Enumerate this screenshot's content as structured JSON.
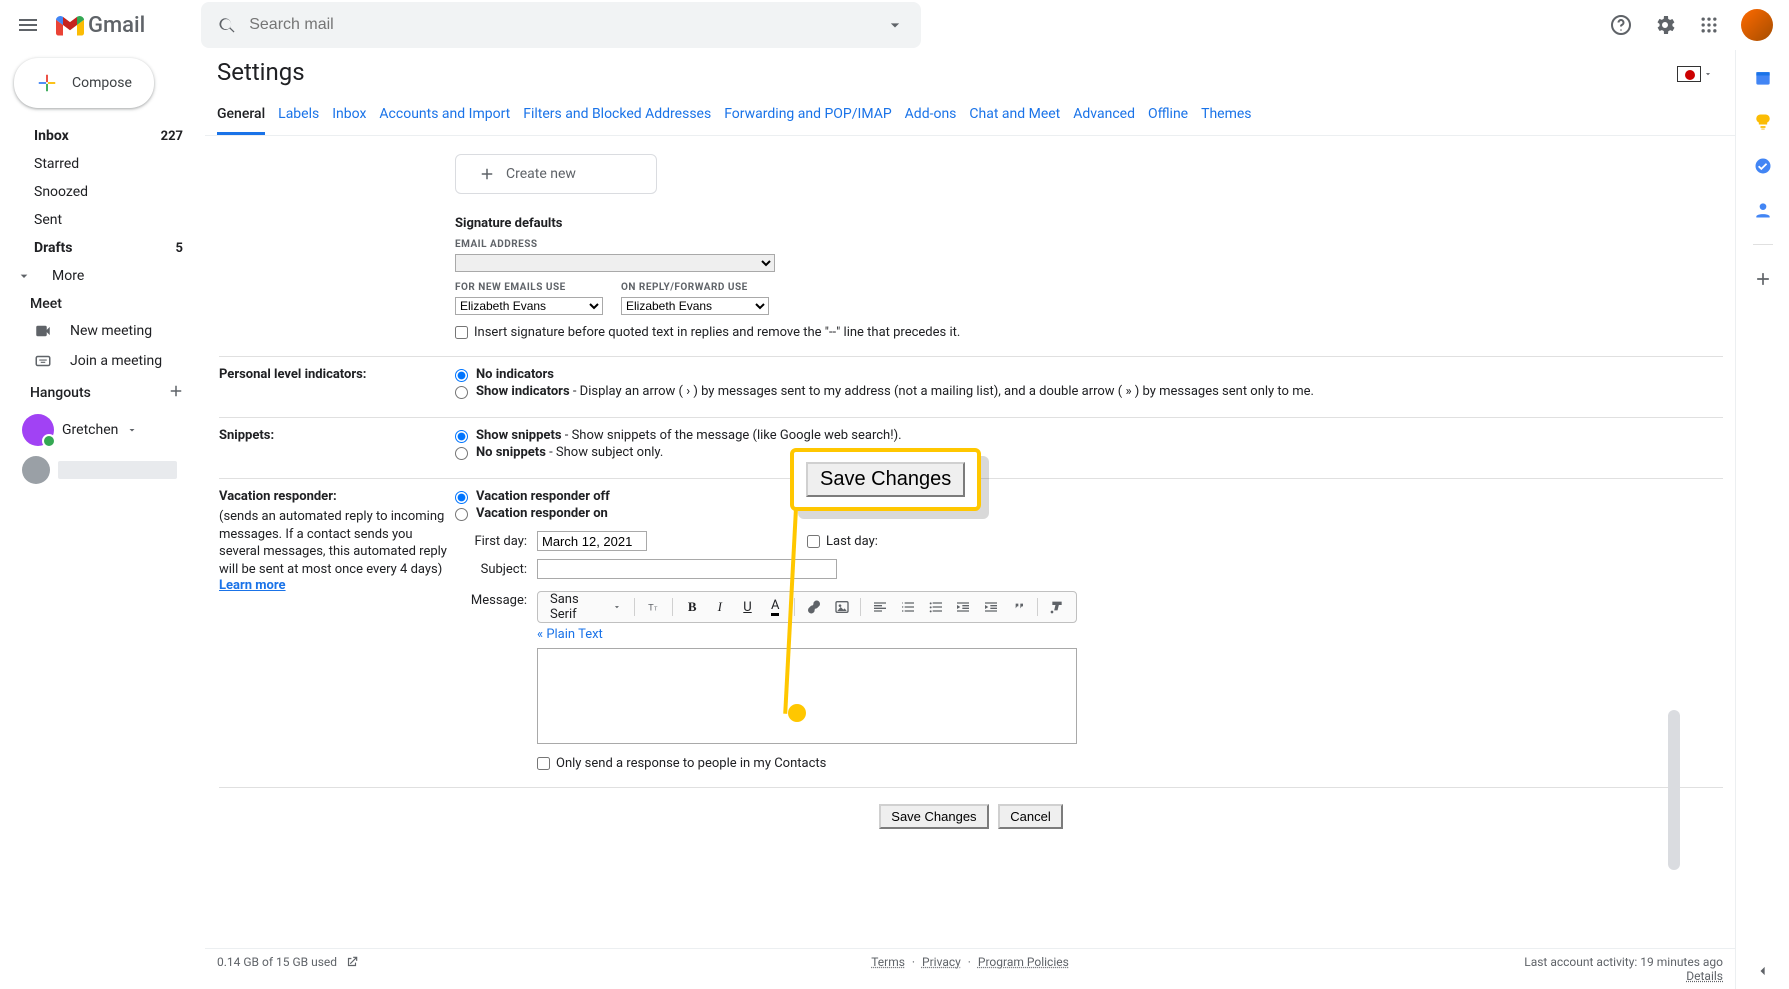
{
  "header": {
    "search_placeholder": "Search mail",
    "logo_text": "Gmail"
  },
  "sidebar": {
    "compose_label": "Compose",
    "items": [
      {
        "label": "Inbox",
        "count": "227",
        "bold": true
      },
      {
        "label": "Starred"
      },
      {
        "label": "Snoozed"
      },
      {
        "label": "Sent"
      },
      {
        "label": "Drafts",
        "count": "5",
        "bold": true
      },
      {
        "label": "More"
      }
    ],
    "meet_header": "Meet",
    "meet_items": [
      {
        "label": "New meeting"
      },
      {
        "label": "Join a meeting"
      }
    ],
    "hangouts_header": "Hangouts",
    "hangouts_user": "Gretchen"
  },
  "page": {
    "title": "Settings",
    "tabs": [
      "General",
      "Labels",
      "Inbox",
      "Accounts and Import",
      "Filters and Blocked Addresses",
      "Forwarding and POP/IMAP",
      "Add-ons",
      "Chat and Meet",
      "Advanced",
      "Offline",
      "Themes"
    ],
    "active_tab_index": 0
  },
  "signature": {
    "create_new_label": "Create new",
    "defaults_title": "Signature defaults",
    "email_address_label": "EMAIL ADDRESS",
    "new_emails_label": "FOR NEW EMAILS USE",
    "reply_label": "ON REPLY/FORWARD USE",
    "new_emails_value": "Elizabeth Evans",
    "reply_value": "Elizabeth Evans",
    "insert_text": "Insert signature before quoted text in replies and remove the \"--\" line that precedes it."
  },
  "indicators": {
    "row_label": "Personal level indicators:",
    "opt_none": "No indicators",
    "opt_show_pre": "Show indicators",
    "opt_show_post": "- Display an arrow ( › ) by messages sent to my address (not a mailing list), and a double arrow ( » ) by messages sent only to me."
  },
  "snippets": {
    "row_label": "Snippets:",
    "opt_show_pre": "Show snippets",
    "opt_show_post": "- Show snippets of the message (like Google web search!).",
    "opt_no_pre": "No snippets",
    "opt_no_post": "- Show subject only."
  },
  "vacation": {
    "row_label": "Vacation responder:",
    "desc": "(sends an automated reply to incoming messages. If a contact sends you several messages, this automated reply will be sent at most once every 4 days)",
    "learn_more": "Learn more",
    "opt_off": "Vacation responder off",
    "opt_on": "Vacation responder on",
    "first_day_label": "First day:",
    "first_day_value": "March 12, 2021",
    "last_day_label": "Last day:",
    "subject_label": "Subject:",
    "subject_value": "",
    "message_label": "Message:",
    "font_name": "Sans Serif",
    "plain_text_link": "« Plain Text",
    "only_send_label": "Only send a response to people in my Contacts"
  },
  "buttons": {
    "save": "Save Changes",
    "cancel": "Cancel"
  },
  "footer": {
    "storage": "0.14 GB of 15 GB used",
    "terms": "Terms",
    "privacy": "Privacy",
    "policies": "Program Policies",
    "sep": "·",
    "activity": "Last account activity: 19 minutes ago",
    "details": "Details"
  },
  "callout": {
    "button_label": "Save Changes"
  }
}
